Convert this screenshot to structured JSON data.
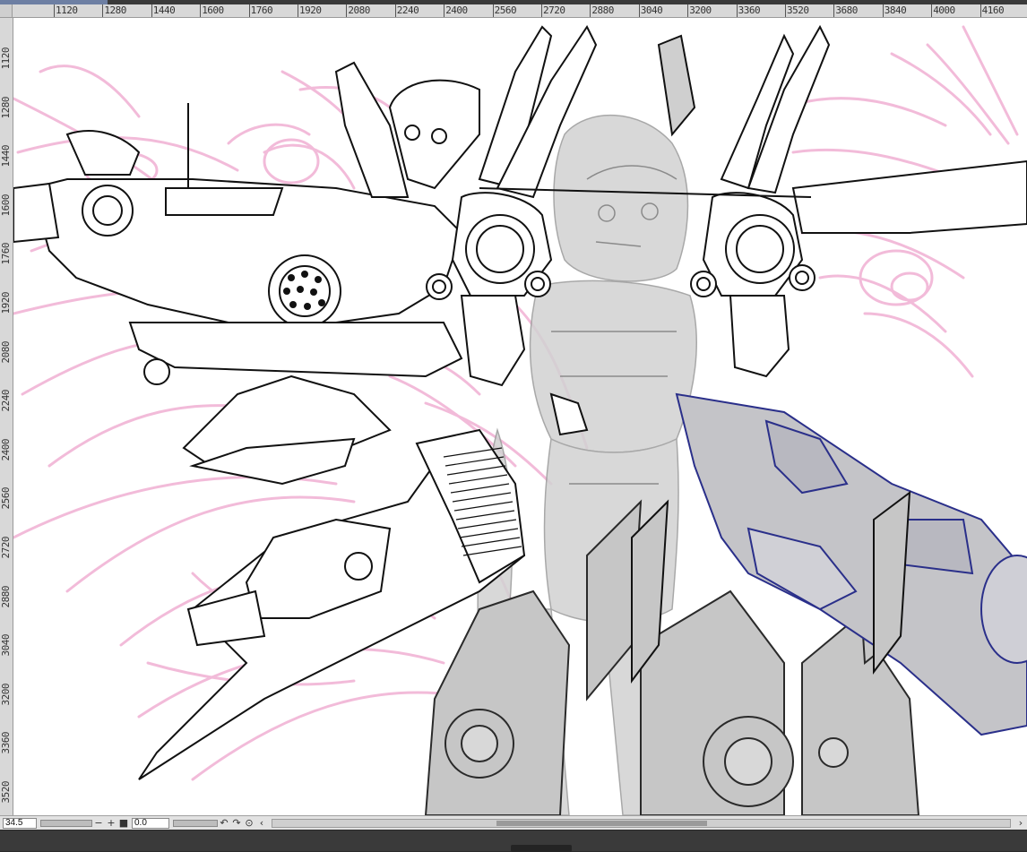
{
  "ruler": {
    "horizontal_labels": [
      "1120",
      "1280",
      "1440",
      "1600",
      "1760",
      "1920",
      "2080",
      "2240",
      "2400",
      "2560",
      "2720",
      "2880",
      "3040",
      "3200",
      "3360",
      "3520",
      "3680",
      "3840",
      "4000",
      "4160"
    ],
    "vertical_labels": [
      "1120",
      "1280",
      "1440",
      "1600",
      "1760",
      "1920",
      "2080",
      "2240",
      "2400",
      "2560",
      "2720",
      "2880",
      "3040",
      "3200",
      "3360",
      "3520"
    ]
  },
  "statusbar": {
    "zoom": "34.5",
    "rotation": "0.0",
    "zoom_out": "−",
    "zoom_in": "+",
    "fit": "■",
    "rotate_left": "↶",
    "rotate_right": "↷",
    "reset_rotation": "⊙",
    "scroll_left": "‹",
    "scroll_right": "›"
  },
  "colors": {
    "sketch": "#f2b8d8",
    "lineart": "#1a1a1a",
    "gray_layer": "#c9c9c9",
    "blue_layer": "#2a2f8a"
  }
}
